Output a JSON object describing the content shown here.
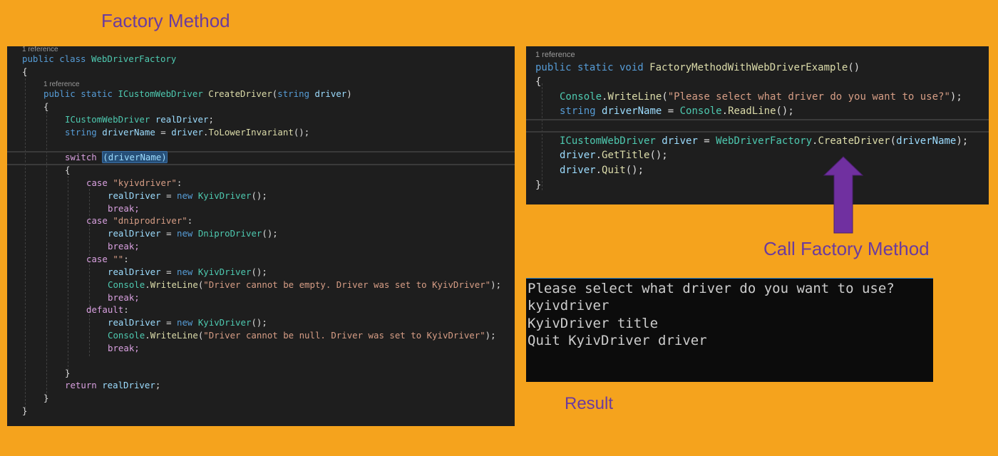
{
  "titles": {
    "factory_method": "Factory Method",
    "call_factory_method": "Call Factory Method",
    "result": "Result"
  },
  "colors": {
    "background": "#F5A31D",
    "title_purple": "#6B3B9E",
    "editor_bg": "#1E1E1E",
    "console_bg": "#0C0C0C",
    "arrow": "#7030A0"
  },
  "left_code": {
    "ref1": "1 reference",
    "l1_kw": "public class ",
    "l1_ty": "WebDriverFactory",
    "l2": "{",
    "ref2": "1 reference",
    "l3_kw": "public static ",
    "l3_ty": "ICustomWebDriver ",
    "l3_fn": "CreateDriver",
    "l3_p1": "(",
    "l3_kw2": "string ",
    "l3_id": "driver",
    "l3_p2": ")",
    "l4": "{",
    "l5_ty": "ICustomWebDriver ",
    "l5_id": "realDriver",
    "l5_p": ";",
    "l6_kw": "string ",
    "l6_id": "driverName",
    "l6_p1": " = ",
    "l6_id2": "driver",
    "l6_p2": ".",
    "l6_fn": "ToLowerInvariant",
    "l6_p3": "();",
    "l7_ct": "switch",
    "l7_p1": " ",
    "l7_sel": "(driverName)",
    "l8": "{",
    "l9_ct": "case ",
    "l9_st": "\"kyivdriver\"",
    "l9_p": ":",
    "l10_id": "realDriver",
    "l10_p1": " = ",
    "l10_kw": "new ",
    "l10_ty": "KyivDriver",
    "l10_p2": "();",
    "l11": "break;",
    "l12_ct": "case ",
    "l12_st": "\"dniprodriver\"",
    "l12_p": ":",
    "l13_id": "realDriver",
    "l13_p1": " = ",
    "l13_kw": "new ",
    "l13_ty": "DniproDriver",
    "l13_p2": "();",
    "l14": "break;",
    "l15_ct": "case ",
    "l15_st": "\"\"",
    "l15_p": ":",
    "l16_id": "realDriver",
    "l16_p1": " = ",
    "l16_kw": "new ",
    "l16_ty": "KyivDriver",
    "l16_p2": "();",
    "l17_ty": "Console",
    "l17_p1": ".",
    "l17_fn": "WriteLine",
    "l17_p2": "(",
    "l17_st": "\"Driver cannot be empty. Driver was set to KyivDriver\"",
    "l17_p3": ");",
    "l18": "break;",
    "l19_ct": "default",
    "l19_p": ":",
    "l20_id": "realDriver",
    "l20_p1": " = ",
    "l20_kw": "new ",
    "l20_ty": "KyivDriver",
    "l20_p2": "();",
    "l21_ty": "Console",
    "l21_p1": ".",
    "l21_fn": "WriteLine",
    "l21_p2": "(",
    "l21_st": "\"Driver cannot be null. Driver was set to KyivDriver\"",
    "l21_p3": ");",
    "l22": "break;",
    "l23": "}",
    "l24_ct": "return ",
    "l24_id": "realDriver",
    "l24_p": ";",
    "l25": "}",
    "l26": "}"
  },
  "right_code": {
    "ref": "1 reference",
    "l1_kw": "public static void ",
    "l1_fn": "FactoryMethodWithWebDriverExample",
    "l1_p": "()",
    "l2": "{",
    "l3_ty": "Console",
    "l3_p1": ".",
    "l3_fn": "WriteLine",
    "l3_p2": "(",
    "l3_st": "\"Please select what driver do you want to use?\"",
    "l3_p3": ");",
    "l4_kw": "string ",
    "l4_id": "driverName",
    "l4_p1": " = ",
    "l4_ty": "Console",
    "l4_p2": ".",
    "l4_fn": "ReadLine",
    "l4_p3": "();",
    "l5_ty": "ICustomWebDriver ",
    "l5_id": "driver",
    "l5_p1": " = ",
    "l5_ty2": "WebDriverFactory",
    "l5_p2": ".",
    "l5_fn": "CreateDriver",
    "l5_p3": "(",
    "l5_id2": "driverName",
    "l5_p4": ");",
    "l6_id": "driver",
    "l6_p1": ".",
    "l6_fn": "GetTitle",
    "l6_p2": "();",
    "l7_id": "driver",
    "l7_p1": ".",
    "l7_fn": "Quit",
    "l7_p2": "();",
    "l8": "}"
  },
  "console": {
    "lines": [
      "Please select what driver do you want to use?",
      "kyivdriver",
      "KyivDriver title",
      "Quit KyivDriver driver"
    ]
  }
}
